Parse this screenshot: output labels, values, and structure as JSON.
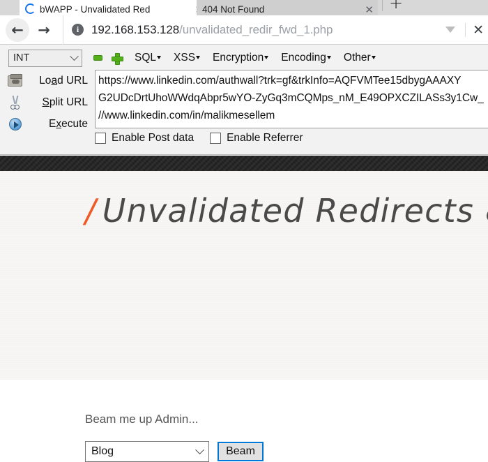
{
  "browser": {
    "tabs": [
      {
        "title": "bWAPP - Unvalidated Red",
        "close_label": "✕",
        "favicon": "loading-spinner-icon",
        "active": true
      },
      {
        "title": "404 Not Found",
        "close_label": "✕",
        "favicon": "none",
        "active": false
      }
    ],
    "new_tab_label": "+",
    "nav": {
      "back_label": "←",
      "forward_label": "→",
      "info_icon_label": "i",
      "url_host": "192.168.153.128",
      "url_path": "/unvalidated_redir_fwd_1.php",
      "dropdown_icon": "chevron-down-icon",
      "close_label": "✕"
    }
  },
  "hackbar": {
    "encoding_select": {
      "value": "INT",
      "chevron": "chevron-down-icon"
    },
    "minus_icon": "minus-icon",
    "plus_icon": "plus-icon",
    "menus": [
      {
        "label": "SQL"
      },
      {
        "label": "XSS"
      },
      {
        "label": "Encryption"
      },
      {
        "label": "Encoding"
      },
      {
        "label": "Other"
      }
    ],
    "actions": [
      {
        "label_pre": "Lo",
        "label_key": "a",
        "label_post": "d URL",
        "icon": "load-url-icon"
      },
      {
        "label_pre": "",
        "label_key": "S",
        "label_post": "plit URL",
        "icon": "scissors-icon"
      },
      {
        "label_pre": "E",
        "label_key": "x",
        "label_post": "ecute",
        "icon": "play-icon"
      }
    ],
    "url_lines": [
      "https://www.linkedin.com/authwall?trk=gf&trkInfo=AQFVMTee15dbygAAAXY",
      "G2UDcDrtUhoWWdqAbpr5wYO-ZyGq3mCQMps_nM_E49OPXCZILASs3y1Cw_",
      "//www.linkedin.com/in/malikmesellem"
    ],
    "checkboxes": [
      {
        "label": "Enable Post data",
        "checked": false
      },
      {
        "label": "Enable Referrer",
        "checked": false
      }
    ]
  },
  "page": {
    "title_slash": "/",
    "title_text": "Unvalidated Redirects &",
    "prompt": "Beam me up Admin...",
    "select_value": "Blog",
    "select_chevron": "chevron-down-icon",
    "submit_label": "Beam"
  },
  "colors": {
    "accent_orange": "#f05a28",
    "focus_blue": "#0078d7",
    "hackbar_green": "#54b018",
    "band_dark": "#2b2b2b"
  }
}
